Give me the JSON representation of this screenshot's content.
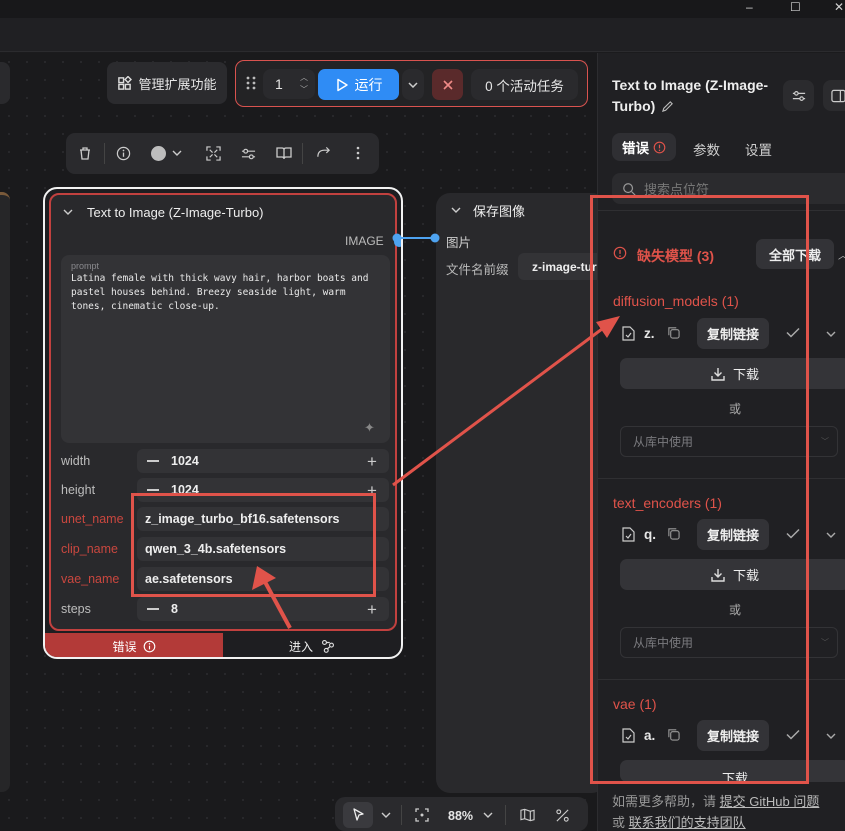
{
  "window": {
    "minimize": "–",
    "maximize": "☐",
    "close": "✕"
  },
  "toolbar": {
    "manage_extensions": "管理扩展功能",
    "queue_count": "1",
    "run_label": "运行",
    "active_tasks": "0 个活动任务"
  },
  "node": {
    "title": "Text to Image (Z-Image-Turbo)",
    "output_label": "IMAGE",
    "prompt_label": "prompt",
    "prompt_text": "Latina female with thick wavy hair, harbor boats and pastel houses behind. Breezy seaside light, warm tones, cinematic close-up.",
    "fields": [
      {
        "label": "width",
        "value": "1024"
      },
      {
        "label": "height",
        "value": "1024"
      },
      {
        "label": "unet_name",
        "value": "z_image_turbo_bf16.safetensors"
      },
      {
        "label": "clip_name",
        "value": "qwen_3_4b.safetensors"
      },
      {
        "label": "vae_name",
        "value": "ae.safetensors"
      },
      {
        "label": "steps",
        "value": "8"
      }
    ],
    "error_tab": "错误",
    "enter_tab": "进入"
  },
  "save_node": {
    "title": "保存图像",
    "input_label": "图片",
    "prefix_label": "文件名前缀",
    "prefix_value": "z-image-tur"
  },
  "panel": {
    "title_line1": "Text to Image (Z-Image-",
    "title_line2": "Turbo)",
    "tabs": [
      "错误",
      "参数",
      "设置"
    ],
    "search_placeholder": "搜索点位符",
    "missing_models": "缺失模型 (3)",
    "download_all": "全部下载",
    "groups": [
      {
        "name": "diffusion_models (1)",
        "file": "z.",
        "copy": "复制链接",
        "download": "下载",
        "or": "或",
        "use_library": "从库中使用"
      },
      {
        "name": "text_encoders (1)",
        "file": "q.",
        "copy": "复制链接",
        "download": "下载",
        "or": "或",
        "use_library": "从库中使用"
      },
      {
        "name": "vae (1)",
        "file": "a.",
        "copy": "复制链接",
        "download": "下载"
      }
    ],
    "help_text": "如需更多帮助，请",
    "help_link1": "提交 GitHub 问题",
    "help_or": "或",
    "help_link2": "联系我们的支持团队"
  },
  "bottom_bar": {
    "zoom": "88%"
  },
  "colors": {
    "accent_blue": "#2f8cf5",
    "error_red": "#e0534a",
    "node_error": "#b33a38"
  }
}
